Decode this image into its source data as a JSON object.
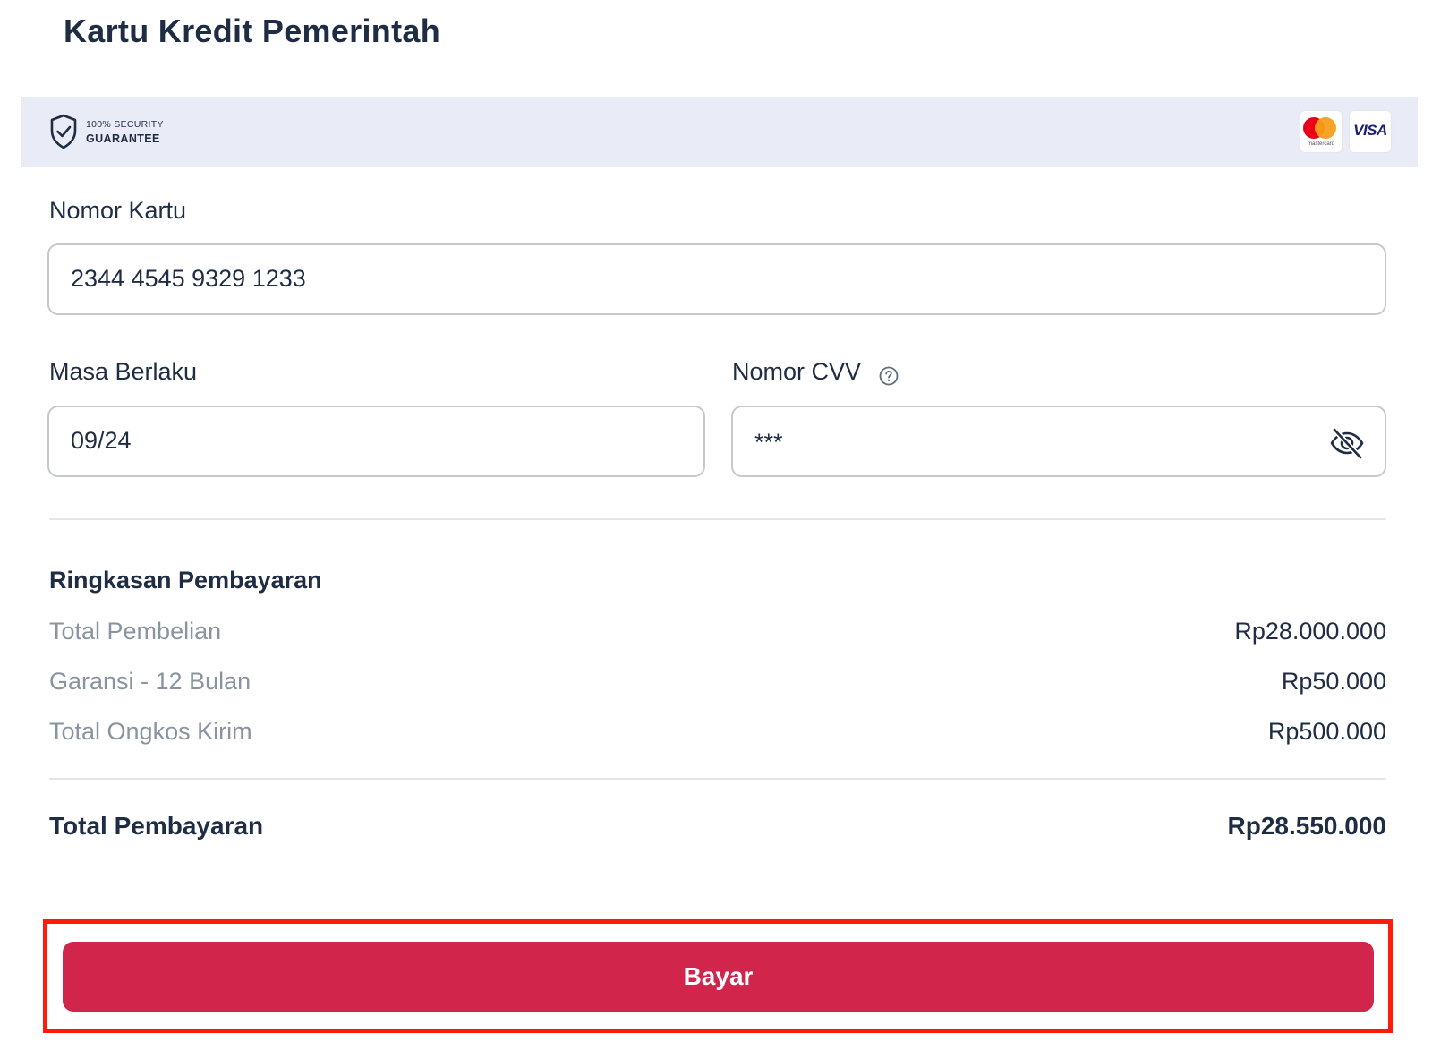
{
  "page": {
    "title": "Kartu Kredit Pemerintah"
  },
  "security": {
    "line1": "100% SECURITY",
    "line2": "GUARANTEE",
    "cards": [
      {
        "name": "mastercard",
        "label": "mastercard",
        "colors": [
          "#eb001b",
          "#f79e1b"
        ]
      },
      {
        "name": "visa",
        "label": "VISA",
        "color": "#1a1f71"
      }
    ]
  },
  "form": {
    "card_number": {
      "label": "Nomor Kartu",
      "value": "2344 4545 9329 1233"
    },
    "expiry": {
      "label": "Masa Berlaku",
      "value": "09/24"
    },
    "cvv": {
      "label": "Nomor CVV",
      "value": "***",
      "help_icon": "help-circle-icon",
      "toggle_icon": "eye-off-icon"
    }
  },
  "summary": {
    "title": "Ringkasan Pembayaran",
    "rows": [
      {
        "label": "Total Pembelian",
        "value": "Rp28.000.000"
      },
      {
        "label": "Garansi - 12 Bulan",
        "value": "Rp50.000"
      },
      {
        "label": "Total Ongkos Kirim",
        "value": "Rp500.000"
      }
    ],
    "total": {
      "label": "Total Pembayaran",
      "value": "Rp28.550.000"
    }
  },
  "actions": {
    "pay_label": "Bayar"
  },
  "colors": {
    "primary": "#d1254c",
    "text_dark": "#1f2d44",
    "text_muted": "#8a93a0",
    "security_bg": "#e9ecf6",
    "highlight": "#ff1a0a"
  }
}
